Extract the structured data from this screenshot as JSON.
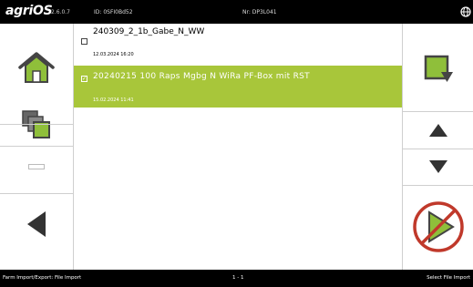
{
  "header": {
    "brand": "agriOS",
    "brand_version": "2.6.0.7",
    "status_left": "ID: 0SFI0Bd52",
    "status_center": "Nr: DP3L041"
  },
  "files": [
    {
      "name": "240309_2_1b_Gabe_N_WW",
      "date": "12.03.2024 16:20",
      "selected": false
    },
    {
      "name": "20240215 100 Raps Mgbg N WiRa PF-Box mit RST",
      "date": "15.02.2024 11:41",
      "selected": true
    }
  ],
  "footer": {
    "left": "Farm Import/Export: File Import",
    "page": "1 - 1",
    "right": "Select File Import"
  },
  "colors": {
    "accent": "#a8c63a",
    "icon_green": "#8fbf3a",
    "confirm_red": "#c0392b"
  },
  "icons": [
    "home-icon",
    "copy-icon",
    "back-arrow-icon",
    "export-icon",
    "up-arrow-icon",
    "down-arrow-icon",
    "confirm-icon",
    "globe-icon"
  ]
}
